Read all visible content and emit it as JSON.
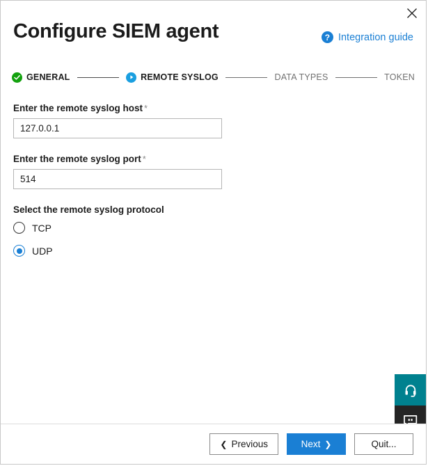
{
  "window": {
    "close_label": "✕"
  },
  "header": {
    "title": "Configure SIEM agent",
    "integration_guide_label": "Integration guide",
    "help_icon_glyph": "?",
    "link_color": "#1a7fd4"
  },
  "stepper": {
    "steps": [
      {
        "label": "GENERAL",
        "state": "done",
        "marker": "check-icon"
      },
      {
        "label": "REMOTE SYSLOG",
        "state": "current",
        "marker": "play-icon"
      },
      {
        "label": "DATA TYPES",
        "state": "todo",
        "marker": "none"
      },
      {
        "label": "TOKEN",
        "state": "todo",
        "marker": "none"
      }
    ],
    "done_color": "#13a10e",
    "current_color": "#1a9fe0",
    "todo_color": "#707070"
  },
  "form": {
    "host": {
      "label": "Enter the remote syslog host",
      "required_mark": "*",
      "value": "127.0.0.1",
      "placeholder": "127.0.0.1"
    },
    "port": {
      "label": "Enter the remote syslog port",
      "required_mark": "*",
      "value": "514",
      "placeholder": "514"
    },
    "protocol": {
      "label": "Select the remote syslog protocol",
      "options": [
        {
          "label": "TCP",
          "selected": false
        },
        {
          "label": "UDP",
          "selected": true
        }
      ],
      "selected_value": "UDP",
      "accent_color": "#1a7fd4"
    }
  },
  "side_widgets": [
    {
      "name": "support",
      "icon": "headset-icon",
      "color": "#00818f"
    },
    {
      "name": "chat",
      "icon": "chat-bubble-icon",
      "color": "#242424"
    }
  ],
  "footer": {
    "previous_label": "Previous",
    "previous_chevron": "❮",
    "next_label": "Next",
    "next_chevron": "❯",
    "quit_label": "Quit...",
    "primary_color": "#1a7fd4"
  }
}
